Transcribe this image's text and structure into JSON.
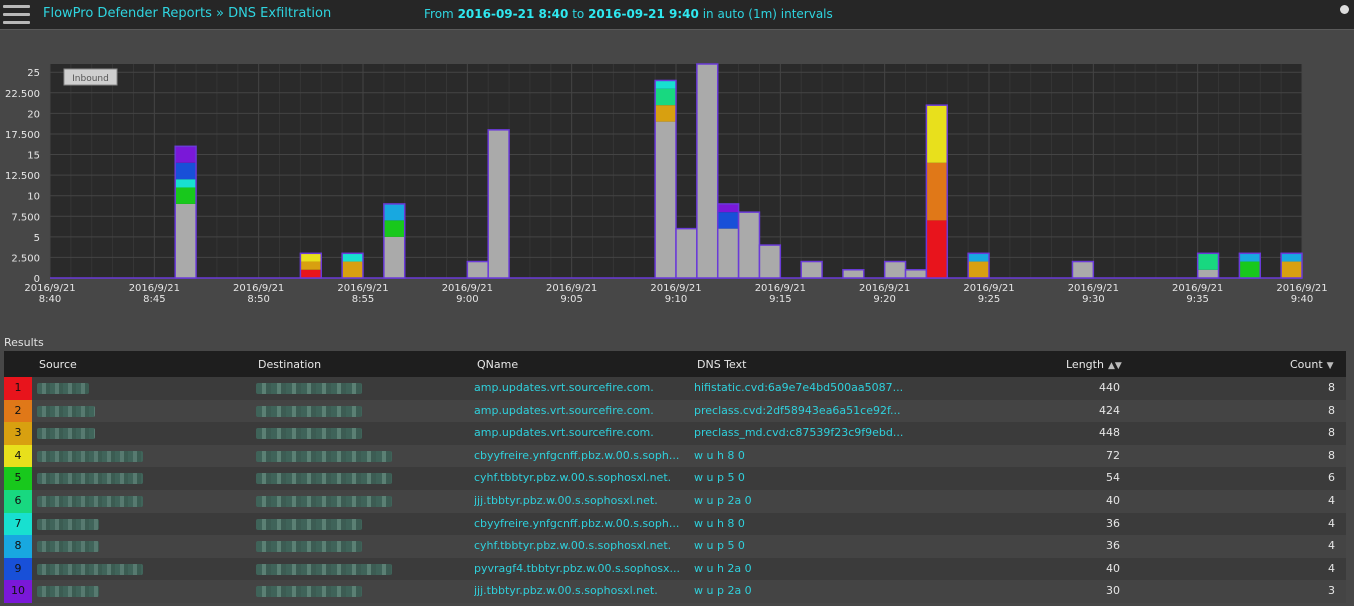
{
  "header": {
    "crumb": "FlowPro Defender Reports » DNS Exfiltration",
    "from_label": "From",
    "from_value": "2016-09-21 8:40",
    "to_label": "to",
    "to_value": "2016-09-21 9:40",
    "interval_label": "in auto (1m) intervals"
  },
  "chart_data": {
    "type": "bar",
    "stacked": true,
    "title": "",
    "legend_badge": "Inbound",
    "ylim": [
      0,
      26
    ],
    "y_ticks": [
      {
        "v": 0,
        "label": "0"
      },
      {
        "v": 2.5,
        "label": "2.500"
      },
      {
        "v": 5,
        "label": "5"
      },
      {
        "v": 7.5,
        "label": "7.500"
      },
      {
        "v": 10,
        "label": "10"
      },
      {
        "v": 12.5,
        "label": "12.500"
      },
      {
        "v": 15,
        "label": "15"
      },
      {
        "v": 17.5,
        "label": "17.500"
      },
      {
        "v": 20,
        "label": "20"
      },
      {
        "v": 22.5,
        "label": "22.500"
      },
      {
        "v": 25,
        "label": "25"
      }
    ],
    "x_ticks": [
      {
        "m": 0,
        "d": "2016/9/21",
        "t": "8:40"
      },
      {
        "m": 5,
        "d": "2016/9/21",
        "t": "8:45"
      },
      {
        "m": 10,
        "d": "2016/9/21",
        "t": "8:50"
      },
      {
        "m": 15,
        "d": "2016/9/21",
        "t": "8:55"
      },
      {
        "m": 20,
        "d": "2016/9/21",
        "t": "9:00"
      },
      {
        "m": 25,
        "d": "2016/9/21",
        "t": "9:05"
      },
      {
        "m": 30,
        "d": "2016/9/21",
        "t": "9:10"
      },
      {
        "m": 35,
        "d": "2016/9/21",
        "t": "9:15"
      },
      {
        "m": 40,
        "d": "2016/9/21",
        "t": "9:20"
      },
      {
        "m": 45,
        "d": "2016/9/21",
        "t": "9:25"
      },
      {
        "m": 50,
        "d": "2016/9/21",
        "t": "9:30"
      },
      {
        "m": 55,
        "d": "2016/9/21",
        "t": "9:35"
      },
      {
        "m": 60,
        "d": "2016/9/21",
        "t": "9:40"
      }
    ],
    "colors": {
      "other": "#aaaaaa",
      "c1": "#e8141c",
      "c2": "#e07818",
      "c3": "#d8a010",
      "c4": "#e8e01c",
      "c5": "#18c81c",
      "c6": "#18d880",
      "c7": "#18e0d0",
      "c8": "#18a8e0",
      "c9": "#1850d8",
      "c10": "#7a18d8",
      "outline": "#6a3ad8"
    },
    "bars": [
      {
        "m": 6,
        "stack": [
          [
            "other",
            9
          ],
          [
            "c5",
            2
          ],
          [
            "c7",
            1
          ],
          [
            "c9",
            2
          ],
          [
            "c10",
            2
          ]
        ]
      },
      {
        "m": 12,
        "stack": [
          [
            "c1",
            1
          ],
          [
            "c3",
            1
          ],
          [
            "c4",
            1
          ]
        ]
      },
      {
        "m": 14,
        "stack": [
          [
            "c3",
            2
          ],
          [
            "c7",
            1
          ]
        ]
      },
      {
        "m": 16,
        "stack": [
          [
            "other",
            5
          ],
          [
            "c5",
            2
          ],
          [
            "c8",
            2
          ]
        ]
      },
      {
        "m": 20,
        "stack": [
          [
            "other",
            2
          ]
        ]
      },
      {
        "m": 21,
        "stack": [
          [
            "other",
            18
          ]
        ]
      },
      {
        "m": 29,
        "stack": [
          [
            "other",
            19
          ],
          [
            "c3",
            2
          ],
          [
            "c6",
            2
          ],
          [
            "c7",
            1
          ]
        ]
      },
      {
        "m": 30,
        "stack": [
          [
            "other",
            6
          ]
        ]
      },
      {
        "m": 31,
        "stack": [
          [
            "other",
            26
          ]
        ]
      },
      {
        "m": 32,
        "stack": [
          [
            "other",
            6
          ],
          [
            "c9",
            2
          ],
          [
            "c10",
            1
          ]
        ]
      },
      {
        "m": 33,
        "stack": [
          [
            "other",
            8
          ]
        ]
      },
      {
        "m": 34,
        "stack": [
          [
            "other",
            4
          ]
        ]
      },
      {
        "m": 36,
        "stack": [
          [
            "other",
            2
          ]
        ]
      },
      {
        "m": 38,
        "stack": [
          [
            "other",
            1
          ]
        ]
      },
      {
        "m": 40,
        "stack": [
          [
            "other",
            2
          ]
        ]
      },
      {
        "m": 41,
        "stack": [
          [
            "other",
            1
          ]
        ]
      },
      {
        "m": 42,
        "stack": [
          [
            "c1",
            7
          ],
          [
            "c2",
            7
          ],
          [
            "c4",
            7
          ]
        ]
      },
      {
        "m": 44,
        "stack": [
          [
            "c3",
            2
          ],
          [
            "c8",
            1
          ]
        ]
      },
      {
        "m": 49,
        "stack": [
          [
            "other",
            2
          ]
        ]
      },
      {
        "m": 55,
        "stack": [
          [
            "other",
            1
          ],
          [
            "c6",
            2
          ]
        ]
      },
      {
        "m": 57,
        "stack": [
          [
            "c5",
            2
          ],
          [
            "c8",
            1
          ]
        ]
      },
      {
        "m": 59,
        "stack": [
          [
            "c3",
            2
          ],
          [
            "c8",
            1
          ]
        ]
      }
    ]
  },
  "results": {
    "label": "Results",
    "columns": {
      "source": "Source",
      "destination": "Destination",
      "qname": "QName",
      "dns_text": "DNS Text",
      "length": "Length",
      "count": "Count"
    },
    "rows": [
      {
        "idx": "1",
        "qname": "amp.updates.vrt.sourcefire.com.",
        "dns_text": "hifistatic.cvd:6a9e7e4bd500aa5087...",
        "length": "440",
        "count": "8",
        "color": "#e8141c"
      },
      {
        "idx": "2",
        "qname": "amp.updates.vrt.sourcefire.com.",
        "dns_text": "preclass.cvd:2df58943ea6a51ce92f...",
        "length": "424",
        "count": "8",
        "color": "#e07818"
      },
      {
        "idx": "3",
        "qname": "amp.updates.vrt.sourcefire.com.",
        "dns_text": "preclass_md.cvd:c87539f23c9f9ebd...",
        "length": "448",
        "count": "8",
        "color": "#d8a010"
      },
      {
        "idx": "4",
        "qname": "cbyyfreire.ynfgcnff.pbz.w.00.s.soph...",
        "dns_text": "w u h 8 0",
        "length": "72",
        "count": "8",
        "color": "#e8e01c"
      },
      {
        "idx": "5",
        "qname": "cyhf.tbbtyr.pbz.w.00.s.sophosxl.net.",
        "dns_text": "w u p 5 0",
        "length": "54",
        "count": "6",
        "color": "#18c81c"
      },
      {
        "idx": "6",
        "qname": "jjj.tbbtyr.pbz.w.00.s.sophosxl.net.",
        "dns_text": "w u p 2a 0",
        "length": "40",
        "count": "4",
        "color": "#18d880"
      },
      {
        "idx": "7",
        "qname": "cbyyfreire.ynfgcnff.pbz.w.00.s.soph...",
        "dns_text": "w u h 8 0",
        "length": "36",
        "count": "4",
        "color": "#18e0d0"
      },
      {
        "idx": "8",
        "qname": "cyhf.tbbtyr.pbz.w.00.s.sophosxl.net.",
        "dns_text": "w u p 5 0",
        "length": "36",
        "count": "4",
        "color": "#18a8e0"
      },
      {
        "idx": "9",
        "qname": "pyvragf4.tbbtyr.pbz.w.00.s.sophosx...",
        "dns_text": "w u h 2a 0",
        "length": "40",
        "count": "4",
        "color": "#1850d8"
      },
      {
        "idx": "10",
        "qname": "jjj.tbbtyr.pbz.w.00.s.sophosxl.net.",
        "dns_text": "w u p 2a 0",
        "length": "30",
        "count": "3",
        "color": "#7a18d8"
      }
    ]
  }
}
